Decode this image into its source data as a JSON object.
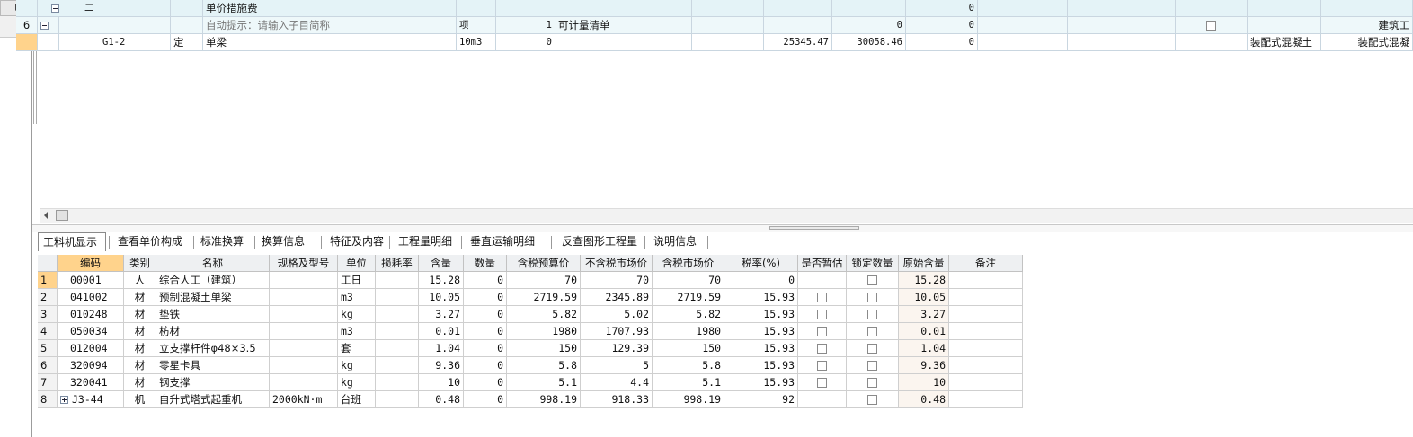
{
  "upper_rows": [
    {
      "rownum": "",
      "tree": "minus",
      "code": "二",
      "type": "",
      "name": "单价措施费",
      "unit": "",
      "qty": "",
      "extra": "",
      "price1": "",
      "price2": "",
      "price3": "0",
      "checkbox": false,
      "col_a": "",
      "col_b": ""
    },
    {
      "rownum": "6",
      "tree": "minus",
      "code": "",
      "type": "",
      "name": "自动提示：请输入子目简称",
      "unit": "项",
      "qty": "1",
      "extra": "可计量清单",
      "price1": "",
      "price2": "0",
      "price3": "0",
      "checkbox": true,
      "col_a": "",
      "col_b": "建筑工"
    },
    {
      "rownum": "",
      "tree": "line",
      "code": "G1-2",
      "type": "定",
      "name": "单梁",
      "unit": "10m3",
      "qty": "0",
      "extra": "",
      "price1": "25345.47",
      "price2": "30058.46",
      "price3": "0",
      "checkbox": false,
      "col_a": "装配式混凝土",
      "col_b": "装配式混凝"
    }
  ],
  "tabs": [
    "工料机显示",
    "查看单价构成",
    "标准换算",
    "换算信息",
    "特征及内容",
    "工程量明细",
    "垂直运输明细",
    "反查图形工程量",
    "说明信息"
  ],
  "headers": [
    "编码",
    "类别",
    "名称",
    "规格及型号",
    "单位",
    "损耗率",
    "含量",
    "数量",
    "含税预算价",
    "不含税市场价",
    "含税市场价",
    "税率(%)",
    "是否暂估",
    "锁定数量",
    "原始含量",
    "备注"
  ],
  "rows": [
    {
      "n": "1",
      "code": "00001",
      "cat": "人",
      "name": "综合人工（建筑）",
      "spec": "",
      "unit": "工日",
      "loss": "",
      "qty": "15.28",
      "amt": "0",
      "p1": "70",
      "p2": "70",
      "p3": "70",
      "tax": "0",
      "est": false,
      "lock": true,
      "orig": "15.28",
      "note": "",
      "expand": false
    },
    {
      "n": "2",
      "code": "041002",
      "cat": "材",
      "name": "预制混凝土单梁",
      "spec": "",
      "unit": "m3",
      "loss": "",
      "qty": "10.05",
      "amt": "0",
      "p1": "2719.59",
      "p2": "2345.89",
      "p3": "2719.59",
      "tax": "15.93",
      "est": true,
      "lock": true,
      "orig": "10.05",
      "note": "",
      "expand": false
    },
    {
      "n": "3",
      "code": "010248",
      "cat": "材",
      "name": "垫铁",
      "spec": "",
      "unit": "kg",
      "loss": "",
      "qty": "3.27",
      "amt": "0",
      "p1": "5.82",
      "p2": "5.02",
      "p3": "5.82",
      "tax": "15.93",
      "est": true,
      "lock": true,
      "orig": "3.27",
      "note": "",
      "expand": false
    },
    {
      "n": "4",
      "code": "050034",
      "cat": "材",
      "name": "枋材",
      "spec": "",
      "unit": "m3",
      "loss": "",
      "qty": "0.01",
      "amt": "0",
      "p1": "1980",
      "p2": "1707.93",
      "p3": "1980",
      "tax": "15.93",
      "est": true,
      "lock": true,
      "orig": "0.01",
      "note": "",
      "expand": false
    },
    {
      "n": "5",
      "code": "012004",
      "cat": "材",
      "name": "立支撑杆件φ48×3.5",
      "spec": "",
      "unit": "套",
      "loss": "",
      "qty": "1.04",
      "amt": "0",
      "p1": "150",
      "p2": "129.39",
      "p3": "150",
      "tax": "15.93",
      "est": true,
      "lock": true,
      "orig": "1.04",
      "note": "",
      "expand": false
    },
    {
      "n": "6",
      "code": "320094",
      "cat": "材",
      "name": "零星卡具",
      "spec": "",
      "unit": "kg",
      "loss": "",
      "qty": "9.36",
      "amt": "0",
      "p1": "5.8",
      "p2": "5",
      "p3": "5.8",
      "tax": "15.93",
      "est": true,
      "lock": true,
      "orig": "9.36",
      "note": "",
      "expand": false
    },
    {
      "n": "7",
      "code": "320041",
      "cat": "材",
      "name": "钢支撑",
      "spec": "",
      "unit": "kg",
      "loss": "",
      "qty": "10",
      "amt": "0",
      "p1": "5.1",
      "p2": "4.4",
      "p3": "5.1",
      "tax": "15.93",
      "est": true,
      "lock": true,
      "orig": "10",
      "note": "",
      "expand": false
    },
    {
      "n": "8",
      "code": "J3-44",
      "cat": "机",
      "name": "自升式塔式起重机",
      "spec": "2000kN·m",
      "unit": "台班",
      "loss": "",
      "qty": "0.48",
      "amt": "0",
      "p1": "998.19",
      "p2": "918.33",
      "p3": "998.19",
      "tax": "92",
      "est": false,
      "lock": true,
      "orig": "0.48",
      "note": "",
      "expand": true
    }
  ]
}
